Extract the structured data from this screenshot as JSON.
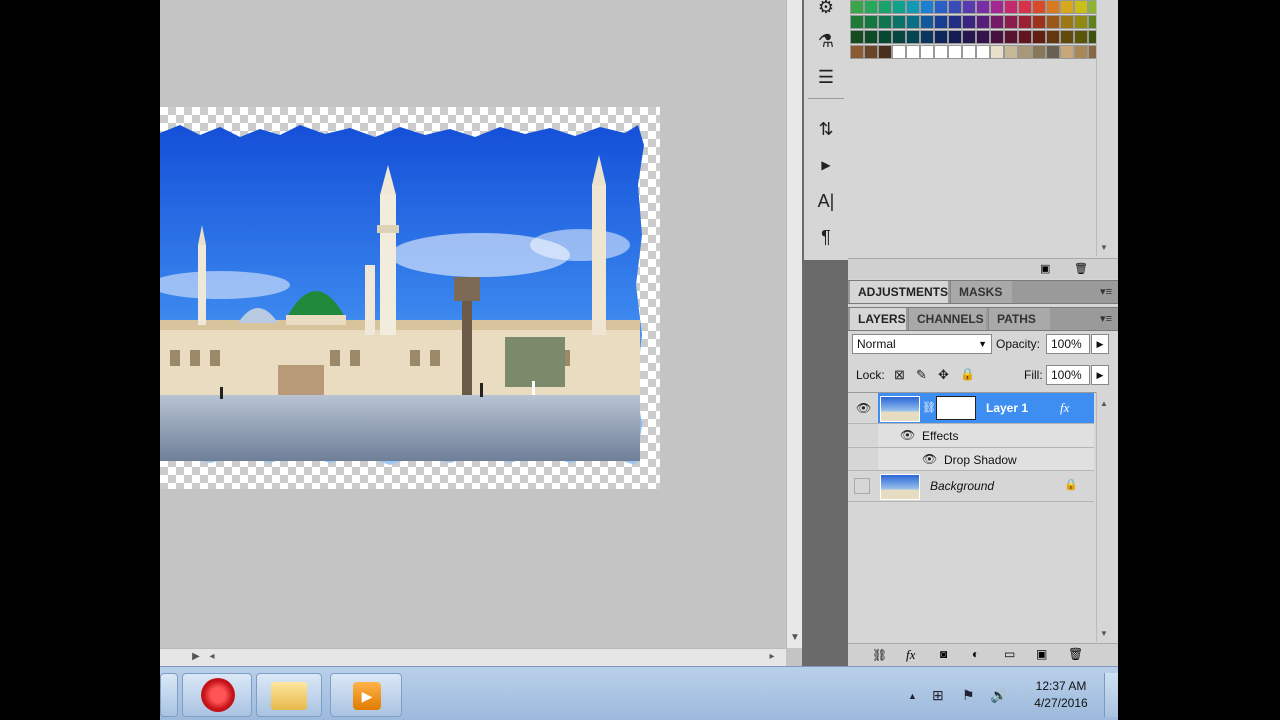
{
  "layers_panel": {
    "adjustments_tab": "ADJUSTMENTS",
    "masks_tab": "MASKS",
    "tabs": [
      "LAYERS",
      "CHANNELS",
      "PATHS"
    ],
    "blend_mode": "Normal",
    "opacity_label": "Opacity:",
    "opacity_value": "100%",
    "lock_label": "Lock:",
    "fill_label": "Fill:",
    "fill_value": "100%",
    "layers": [
      {
        "name": "Layer 1",
        "fx": "fx",
        "selected": true
      },
      {
        "name": "Background",
        "locked": true
      }
    ],
    "effects_label": "Effects",
    "effect_items": [
      "Drop Shadow"
    ]
  },
  "taskbar": {
    "time": "12:37 AM",
    "date": "4/27/2016"
  },
  "icons": {
    "type_tool": "A|",
    "paragraph": "¶",
    "play": "▶"
  },
  "colors": {
    "selected_layer": "#3d8ef0",
    "panel_bg": "#d6d6d6",
    "canvas_bg": "#c4c4c4"
  }
}
